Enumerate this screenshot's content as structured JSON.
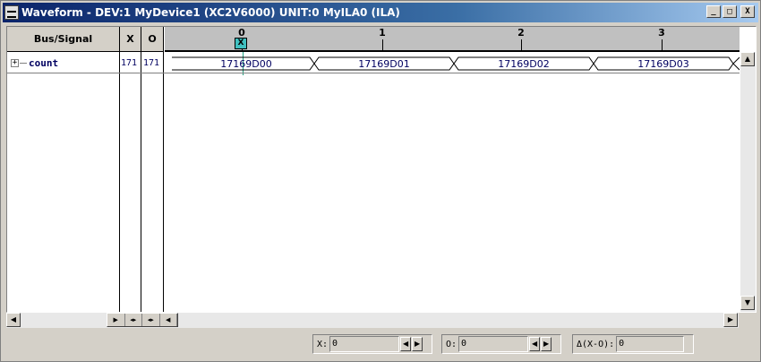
{
  "window": {
    "title": "Waveform - DEV:1 MyDevice1 (XC2V6000) UNIT:0 MyILA0 (ILA)",
    "minimize_label": "_",
    "maximize_label": "□",
    "close_label": "X"
  },
  "columns": {
    "bus_signal": "Bus/Signal",
    "x": "X",
    "o": "O"
  },
  "timeline": {
    "ticks": [
      "0",
      "1",
      "2",
      "3"
    ],
    "cursor_label": "X"
  },
  "signals": [
    {
      "name": "count",
      "expand": "+",
      "x_value": "171",
      "o_value": "171",
      "samples": [
        "17169D00",
        "17169D01",
        "17169D02",
        "17169D03"
      ]
    }
  ],
  "statusbar": {
    "x_label": "X:",
    "x_value": "0",
    "o_label": "O:",
    "o_value": "0",
    "delta_label": "Δ(X-O):",
    "delta_value": "0"
  },
  "icons": {
    "app": "waveform-app-icon",
    "scroll_up": "triangle-up",
    "scroll_down": "triangle-down",
    "scroll_left": "triangle-left",
    "scroll_right": "triangle-right"
  },
  "colors": {
    "titlebar_start": "#0a246a",
    "titlebar_end": "#a6caf0",
    "signal_text": "#000060",
    "cursor": "#40c0c0",
    "chrome": "#d4d0c8"
  }
}
